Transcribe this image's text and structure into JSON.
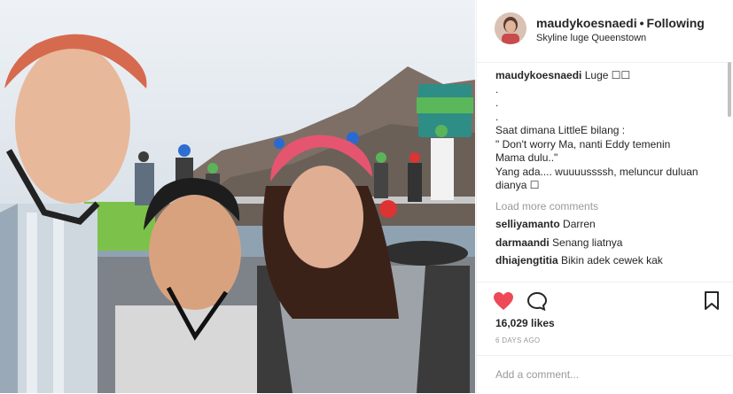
{
  "post": {
    "username": "maudykoesnaedi",
    "separator": "•",
    "follow_label": "Following",
    "location": "Skyline luge Queenstown"
  },
  "caption": {
    "username": "maudykoesnaedi",
    "lines": [
      "Luge ☐☐",
      ".",
      ".",
      ".",
      "Saat dimana LittleE bilang :",
      "\" Don't worry Ma, nanti Eddy temenin",
      "Mama dulu..\"",
      "Yang ada.... wuuuussssh, meluncur duluan",
      "dianya ☐"
    ]
  },
  "load_more": "Load more comments",
  "comments": [
    {
      "user": "selliyamanto",
      "text": "Darren"
    },
    {
      "user": "darmaandi",
      "text": "Senang liatnya"
    },
    {
      "user": "dhiajengtitia",
      "text": "Bikin adek cewek kak"
    }
  ],
  "likes": "16,029 likes",
  "date": "6 DAYS AGO",
  "comment_placeholder": "Add a comment...",
  "colors": {
    "heart": "#ed4956",
    "muted": "#999999",
    "border": "#efefef"
  },
  "icons": [
    "heart-icon",
    "comment-icon",
    "bookmark-icon"
  ]
}
